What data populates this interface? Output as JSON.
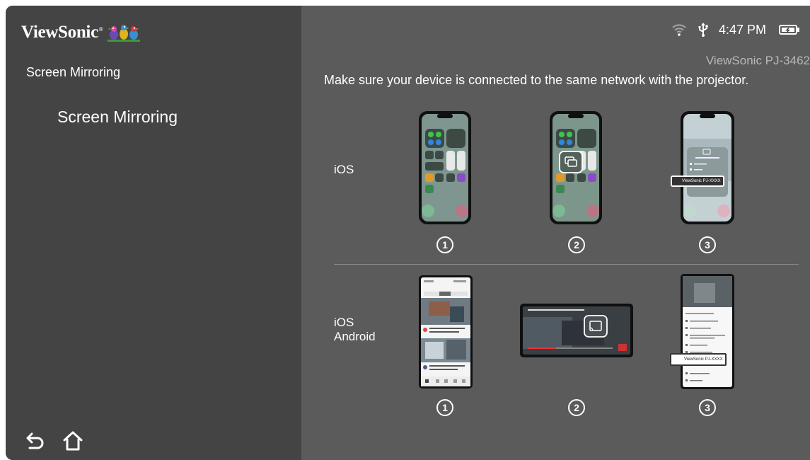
{
  "sidebar": {
    "logo_text": "ViewSonic",
    "logo_mark": "®",
    "section_title": "Screen Mirroring",
    "menu_items": [
      {
        "label": "Screen Mirroring"
      }
    ],
    "nav": {
      "back_icon": "back-arrow-icon",
      "home_icon": "home-icon"
    }
  },
  "status_bar": {
    "wifi_icon": "wifi-icon",
    "usb_icon": "usb-icon",
    "time": "4:47 PM",
    "battery_icon": "battery-icon"
  },
  "device_name": "ViewSonic PJ-3462",
  "instruction": "Make sure your device is connected to the same network with the projector.",
  "sections": [
    {
      "label_lines": [
        "iOS"
      ],
      "steps": [
        "1",
        "2",
        "3"
      ]
    },
    {
      "label_lines": [
        "iOS",
        "Android"
      ],
      "steps": [
        "1",
        "2",
        "3"
      ]
    }
  ],
  "illustrations": {
    "ios_step3_popup": "ViewSonic PJ-XXXX",
    "android_step3_popup": "ViewSonic PJ-XXXX"
  },
  "colors": {
    "sidebar_bg": "#444444",
    "main_bg": "#5b5b5b",
    "text": "#ffffff",
    "muted_text": "#b8b8b8"
  }
}
